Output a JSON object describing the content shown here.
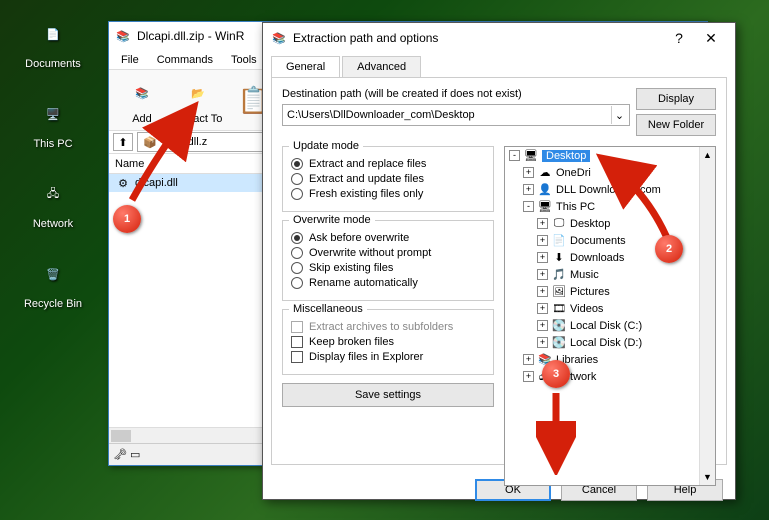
{
  "desktop": {
    "icons": [
      {
        "label": "Documents",
        "glyph": "📄"
      },
      {
        "label": "This PC",
        "glyph": "🖥️"
      },
      {
        "label": "Network",
        "glyph": "🖧"
      },
      {
        "label": "Recycle Bin",
        "glyph": "🗑️"
      }
    ]
  },
  "winrar": {
    "title": "Dlcapi.dll.zip - WinR",
    "menus": [
      "File",
      "Commands",
      "Tools"
    ],
    "toolbar": [
      {
        "label": "Add",
        "icon": "📚"
      },
      {
        "label": "Extract To",
        "icon": "📂"
      }
    ],
    "pathUpGlyph": "⬆",
    "pathIcon": "📦",
    "path": "lcapi.dll.z",
    "columnsHeader": "Name",
    "fileIcon": "⚙",
    "selectedFile": "dlcapi.dll",
    "statusIcon1": "🗝",
    "statusIcon2": "▭"
  },
  "dialog": {
    "title": "Extraction path and options",
    "help": "?",
    "close": "✕",
    "tabs": {
      "general": "General",
      "advanced": "Advanced"
    },
    "destLabel": "Destination path (will be created if does not exist)",
    "destValue": "C:\\Users\\DllDownloader_com\\Desktop",
    "dropGlyph": "⌄",
    "displayBtn": "Display",
    "newFolderBtn": "New Folder",
    "groups": {
      "update": {
        "legend": "Update mode",
        "opts": [
          "Extract and replace files",
          "Extract and update files",
          "Fresh existing files only"
        ],
        "selected": 0
      },
      "overwrite": {
        "legend": "Overwrite mode",
        "opts": [
          "Ask before overwrite",
          "Overwrite without prompt",
          "Skip existing files",
          "Rename automatically"
        ],
        "selected": 0
      },
      "misc": {
        "legend": "Miscellaneous",
        "checks": [
          {
            "label": "Extract archives to subfolders",
            "disabled": true
          },
          {
            "label": "Keep broken files",
            "disabled": false
          },
          {
            "label": "Display files in Explorer",
            "disabled": false
          }
        ]
      }
    },
    "saveBtn": "Save settings",
    "tree": [
      {
        "ind": 0,
        "exp": "-",
        "icon": "🖥",
        "label": "Desktop",
        "sel": true
      },
      {
        "ind": 1,
        "exp": "+",
        "icon": "☁",
        "label": "OneDri"
      },
      {
        "ind": 1,
        "exp": "+",
        "icon": "👤",
        "label": "DLL Downloader.com"
      },
      {
        "ind": 1,
        "exp": "-",
        "icon": "🖥",
        "label": "This PC"
      },
      {
        "ind": 2,
        "exp": "+",
        "icon": "🖵",
        "label": "Desktop"
      },
      {
        "ind": 2,
        "exp": "+",
        "icon": "📄",
        "label": "Documents"
      },
      {
        "ind": 2,
        "exp": "+",
        "icon": "⬇",
        "label": "Downloads"
      },
      {
        "ind": 2,
        "exp": "+",
        "icon": "🎵",
        "label": "Music"
      },
      {
        "ind": 2,
        "exp": "+",
        "icon": "🖼",
        "label": "Pictures"
      },
      {
        "ind": 2,
        "exp": "+",
        "icon": "🎞",
        "label": "Videos"
      },
      {
        "ind": 2,
        "exp": "+",
        "icon": "💽",
        "label": "Local Disk (C:)"
      },
      {
        "ind": 2,
        "exp": "+",
        "icon": "💽",
        "label": "Local Disk (D:)"
      },
      {
        "ind": 1,
        "exp": "+",
        "icon": "📚",
        "label": "Libraries"
      },
      {
        "ind": 1,
        "exp": "+",
        "icon": "🖧",
        "label": "Network"
      }
    ],
    "scrollUp": "▲",
    "scrollDn": "▼",
    "buttons": {
      "ok": "OK",
      "cancel": "Cancel",
      "help": "Help"
    }
  },
  "annotations": {
    "b1": "1",
    "b2": "2",
    "b3": "3"
  }
}
